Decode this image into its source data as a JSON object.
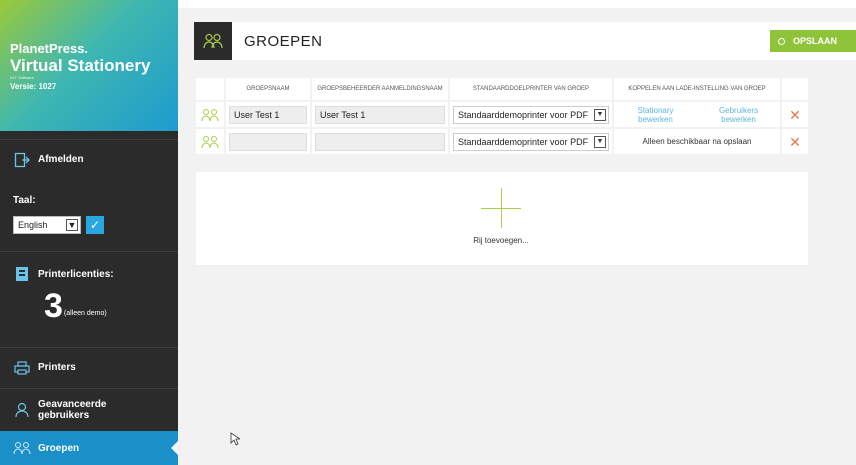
{
  "sidebar": {
    "brand": {
      "line1": "PlanetPress.",
      "line2": "Virtual Stationery",
      "tagline": "XLT Software",
      "version": "Versie: 1027"
    },
    "logout_label": "Afmelden",
    "language": {
      "label": "Taal:",
      "selected": "English"
    },
    "licenses": {
      "label": "Printerlicenties:",
      "count": "3",
      "note": "(alleen demo)"
    },
    "printers_label": "Printers",
    "advanced_users_label": "Geavanceerde gebruikers",
    "groups_label": "Groepen"
  },
  "header": {
    "title": "GROEPEN",
    "save_label": "OPSLAAN"
  },
  "table": {
    "columns": [
      "GROEPSNAAM",
      "GROEPSBEHEERDER AANMELDINGSNAAM",
      "STANDAARDDOELPRINTER VAN GROEP",
      "KOPPELEN AAN LADE-INSTELLING VAN GROEP"
    ],
    "rows": [
      {
        "group_name": "User Test 1",
        "admin_login": "User Test 1",
        "printer": "Standaarddemoprinter voor PDF",
        "link_stationery": "Stationary bewerken",
        "link_users": "Gebruikers bewerken"
      },
      {
        "group_name": "",
        "admin_login": "",
        "printer": "Standaarddemoprinter voor PDF",
        "note": "Alleen beschikbaar na opslaan"
      }
    ],
    "add_row_label": "Rij toevoegen..."
  },
  "colors": {
    "sidebar_bg": "#2b2b2b",
    "active_nav": "#1b8fc8",
    "save_green": "#8fc43a",
    "icon_green": "#a8cf4a",
    "link_blue": "#5fb6e0",
    "delete_orange": "#e8774a"
  },
  "icons": [
    "logout-icon",
    "check-icon",
    "license-icon",
    "printer-icon",
    "user-icon",
    "groups-icon",
    "delete-icon",
    "add-icon",
    "mouse-cursor-icon"
  ]
}
